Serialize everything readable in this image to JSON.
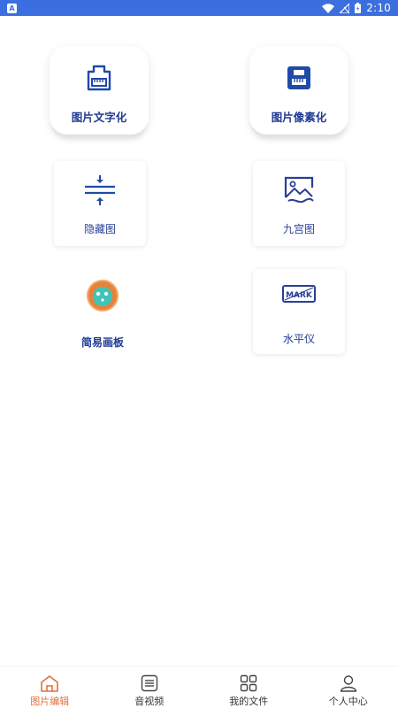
{
  "status_bar": {
    "notification_glyph": "A",
    "time": "2:10",
    "icons": [
      "wifi-icon",
      "no-signal-icon",
      "battery-icon"
    ]
  },
  "tools": [
    {
      "id": "img-to-text",
      "label": "图片文字化",
      "icon": "keyboard-icon"
    },
    {
      "id": "img-pixelate",
      "label": "图片像素化",
      "icon": "pixel-keyboard-icon"
    },
    {
      "id": "hidden-image",
      "label": "隐藏图",
      "icon": "compress-arrows-icon"
    },
    {
      "id": "nine-grid",
      "label": "九宫图",
      "icon": "image-icon"
    },
    {
      "id": "sketchpad",
      "label": "简易画板",
      "icon": "paint-blob-icon"
    },
    {
      "id": "level",
      "label": "水平仪",
      "icon": "mark-stamp-icon"
    }
  ],
  "level_icon_text": "MARK",
  "nav": {
    "active": "图片编辑",
    "items": [
      {
        "label": "图片编辑",
        "icon": "home-icon"
      },
      {
        "label": "音视频",
        "icon": "list-icon"
      },
      {
        "label": "我的文件",
        "icon": "grid-icon"
      },
      {
        "label": "个人中心",
        "icon": "user-icon"
      }
    ]
  },
  "colors": {
    "status_bar": "#3b6fe0",
    "label_blue": "#2a3f96",
    "icon_blue": "#1f4aa8",
    "nav_active": "#e0713a",
    "nav_inactive": "#333333"
  }
}
